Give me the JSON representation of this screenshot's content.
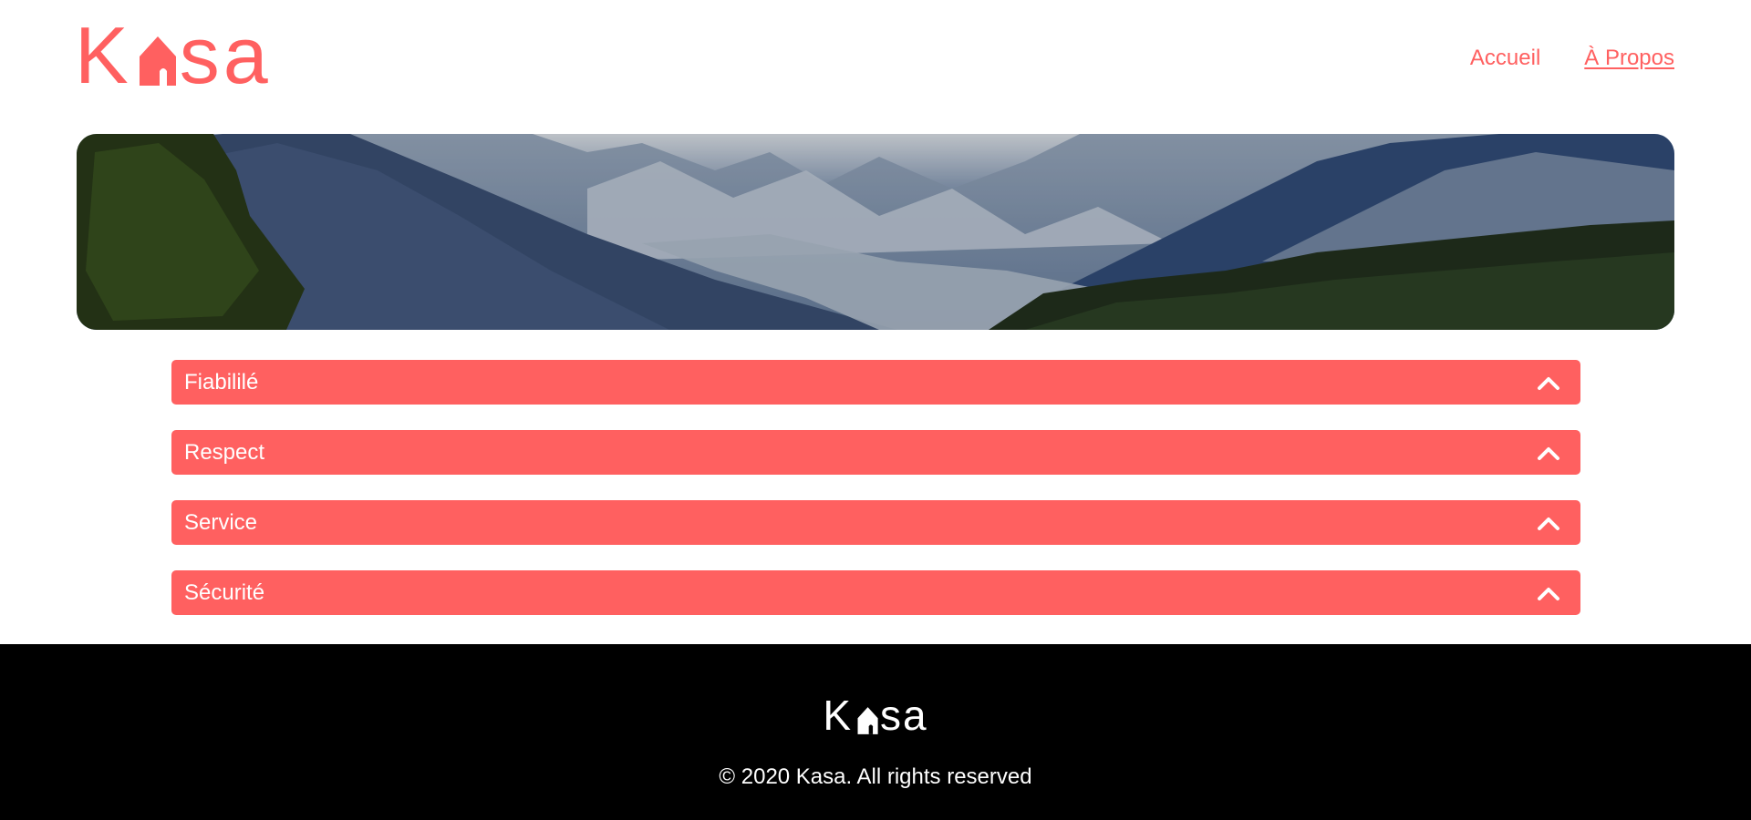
{
  "brand": {
    "name_left": "K",
    "name_right": "sa",
    "accent": "#ff6060",
    "logo_icon": "house-icon"
  },
  "nav": {
    "items": [
      {
        "label": "Accueil",
        "active": false
      },
      {
        "label": "À Propos",
        "active": true
      }
    ]
  },
  "banner": {
    "image": "mountain-valley-landscape"
  },
  "accordion": {
    "items": [
      {
        "title": "Fiabililé",
        "icon": "chevron-up-icon"
      },
      {
        "title": "Respect",
        "icon": "chevron-up-icon"
      },
      {
        "title": "Service",
        "icon": "chevron-up-icon"
      },
      {
        "title": "Sécurité",
        "icon": "chevron-up-icon"
      }
    ]
  },
  "footer": {
    "logo_left": "K",
    "logo_right": "sa",
    "copyright": "© 2020 Kasa. All rights reserved",
    "background": "#000000"
  }
}
